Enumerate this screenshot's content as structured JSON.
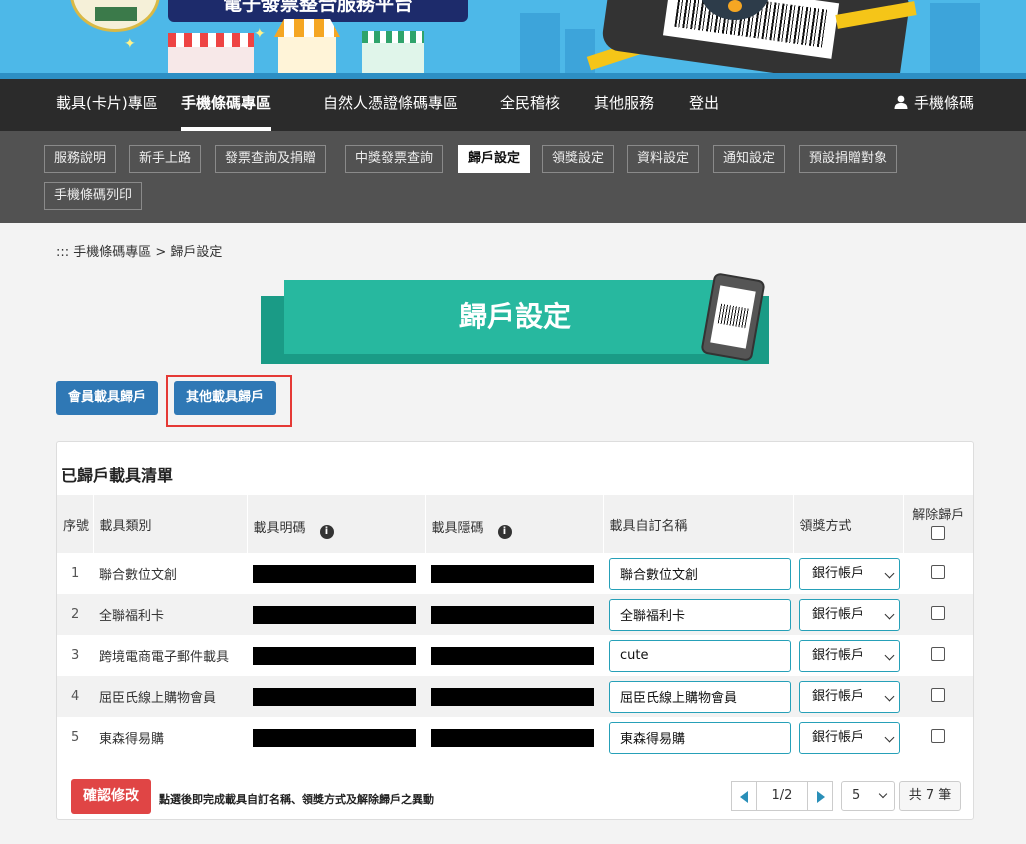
{
  "banner": {
    "platform_title": "電子發票整合服務平台"
  },
  "main_nav": {
    "items": [
      {
        "label": "載具(卡片)專區",
        "active": false
      },
      {
        "label": "手機條碼專區",
        "active": true
      },
      {
        "label": "自然人憑證條碼專區",
        "active": false
      },
      {
        "label": "全民稽核",
        "active": false
      },
      {
        "label": "其他服務",
        "active": false
      },
      {
        "label": "登出",
        "active": false
      }
    ],
    "user_label": "手機條碼",
    "user_icon": "user-icon"
  },
  "sub_nav": {
    "tabs": [
      {
        "label": "服務說明",
        "active": false
      },
      {
        "label": "新手上路",
        "active": false
      },
      {
        "label": "發票查詢及捐贈",
        "active": false
      },
      {
        "label": "中獎發票查詢",
        "active": false
      },
      {
        "label": "歸戶設定",
        "active": true
      },
      {
        "label": "領獎設定",
        "active": false
      },
      {
        "label": "資料設定",
        "active": false
      },
      {
        "label": "通知設定",
        "active": false
      },
      {
        "label": "預設捐贈對象",
        "active": false
      },
      {
        "label": "手機條碼列印",
        "active": false
      }
    ]
  },
  "breadcrumb": "::: 手機條碼專區 > 歸戶設定",
  "page_title": "歸戶設定",
  "carrier_tabs": {
    "member": "會員載具歸戶",
    "other": "其他載具歸戶",
    "highlighted": "other"
  },
  "list": {
    "title": "已歸戶載具清單",
    "columns": {
      "seq": "序號",
      "type": "載具類別",
      "visible_code": "載具明碼",
      "hidden_code": "載具隱碼",
      "custom_name": "載具自訂名稱",
      "award_method": "領獎方式",
      "unlink": "解除歸戶"
    },
    "rows": [
      {
        "seq": "1",
        "type": "聯合數位文創",
        "custom_name": "聯合數位文創",
        "award": "銀行帳戶",
        "unlink": false
      },
      {
        "seq": "2",
        "type": "全聯福利卡",
        "custom_name": "全聯福利卡",
        "award": "銀行帳戶",
        "unlink": false
      },
      {
        "seq": "3",
        "type": "跨境電商電子郵件載具",
        "custom_name": "cute",
        "award": "銀行帳戶",
        "unlink": false
      },
      {
        "seq": "4",
        "type": "屈臣氏線上購物會員",
        "custom_name": "屈臣氏線上購物會員",
        "award": "銀行帳戶",
        "unlink": false
      },
      {
        "seq": "5",
        "type": "東森得易購",
        "custom_name": "東森得易購",
        "award": "銀行帳戶",
        "unlink": false
      }
    ]
  },
  "footer": {
    "confirm_label": "確認修改",
    "confirm_note": "點選後即完成載具自訂名稱、領獎方式及解除歸戶之異動",
    "page_indicator": "1/2",
    "per_page": "5",
    "total": "共 7 筆"
  },
  "colors": {
    "nav_bg": "#2b2b2b",
    "subnav_bg": "#525252",
    "primary_button": "#2f78b5",
    "title_teal": "#27b89f",
    "confirm_red": "#e04545",
    "highlight_red": "#e53935",
    "input_border": "#26a0b8"
  }
}
